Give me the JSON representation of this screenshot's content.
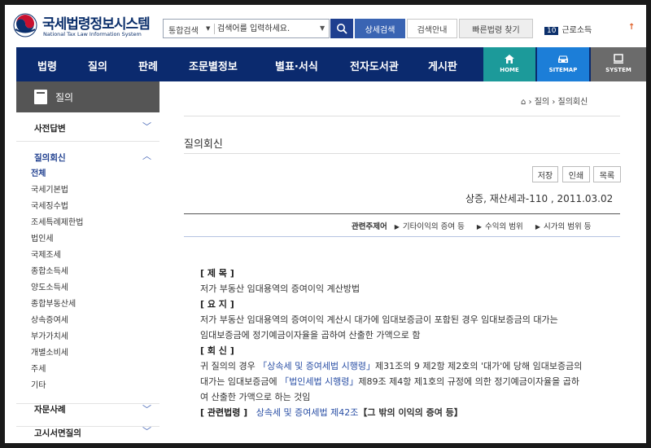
{
  "logo": {
    "title": "국세법령정보시스템",
    "subtitle": "National Tax Law Information System"
  },
  "search": {
    "scope": "통합검색",
    "placeholder": "검색어를 입력하세요.",
    "advanced_label": "상세검색",
    "guide_label": "검색안내",
    "quick_label": "빠른법령 찾기"
  },
  "ranking": {
    "number": "10",
    "keyword": "근로소득"
  },
  "nav": {
    "items": [
      "법령",
      "질의",
      "판례",
      "조문별정보",
      "별표·서식",
      "전자도서관",
      "게시판"
    ],
    "home_label": "HOME",
    "sitemap_label": "SITEMAP",
    "system_label": "SYSTEM"
  },
  "sidebar": {
    "title": "질의",
    "sections": [
      "사전답변",
      "질의회신",
      "자문사례",
      "고시서면질의"
    ],
    "items": [
      "전체",
      "국세기본법",
      "국세징수법",
      "조세특례제한법",
      "법인세",
      "국제조세",
      "종합소득세",
      "양도소득세",
      "종합부동산세",
      "상속증여세",
      "부가가치세",
      "개별소비세",
      "주세",
      "기타"
    ]
  },
  "breadcrumb": {
    "level1": "질의",
    "level2": "질의회신"
  },
  "main": {
    "title": "질의회신",
    "save_label": "저장",
    "print_label": "인쇄",
    "list_label": "목록",
    "doc_ref": "상증, 재산세과-110 , 2011.03.02",
    "topics_label": "관련주제어",
    "topics": [
      "기타이익의 증여 등",
      "수익의 범위",
      "시가의 범위 등"
    ]
  },
  "doc": {
    "subject_label": "[ 제 목 ]",
    "subject": "저가 부동산 임대용역의 증여이익 계산방법",
    "summary_label": "[ 요 지 ]",
    "summary_line1": "저가 부동산 임대용역의 증여이익 계산시 대가에 임대보증금이 포함된 경우 임대보증금의 대가는",
    "summary_line2": "임대보증금에 정기예금이자율을 곱하여 산출한 가액으로 함",
    "reply_label": "[ 회 신 ]",
    "reply_p1": "귀 질의의 경우 ",
    "reply_link1": "「상속세 및 증여세법 시행령」",
    "reply_p2": "제31조의 9 제2항 제2호의 '대가'에 당해 임대보증금의",
    "reply_p3": "대가는 임대보증금에 ",
    "reply_link2": "「법인세법 시행령」",
    "reply_p4": "제89조 제4항 제1호의 규정에 의한 정기예금이자율을 곱하",
    "reply_p5": "여 산출한 가액으로 하는 것임",
    "related_label": "[ 관련법령 ]",
    "related_link": "상속세 및 증여세법 제42조",
    "related_text": "【그 밖의 이익의 증여 등】"
  }
}
